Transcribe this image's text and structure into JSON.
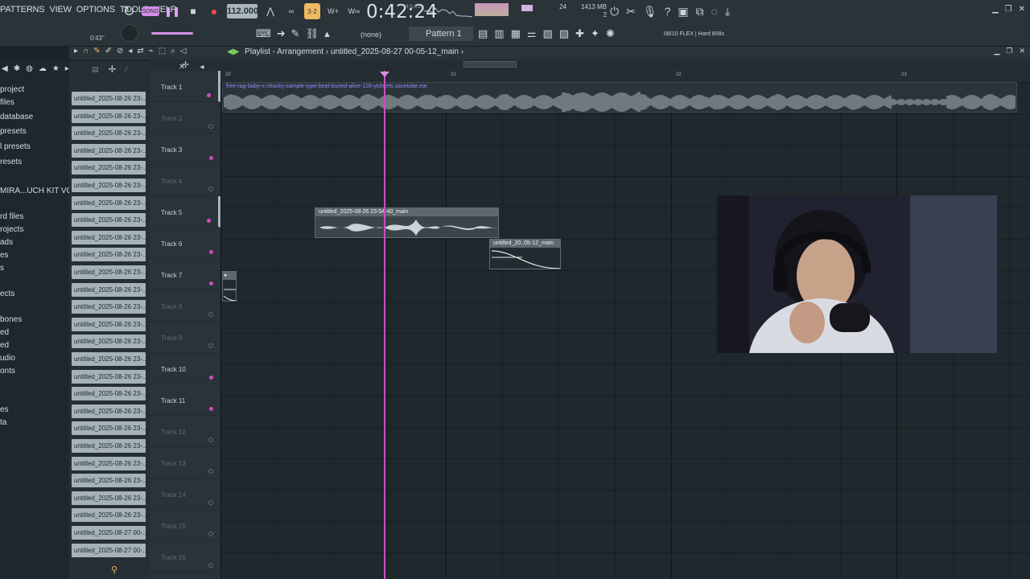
{
  "menu": [
    "PATTERNS",
    "VIEW",
    "OPTIONS",
    "TOOLS",
    "HELP"
  ],
  "transport": {
    "tempo": "112.000",
    "time": "0:42:24",
    "time_unit": "M:S:CS",
    "memory": "1413 MB",
    "memory_sub": "2",
    "cpu": "24",
    "position_label": "0'43\""
  },
  "toolbar2": {
    "none_label": "(none)",
    "pattern": "Pattern 1",
    "preset": "08/10  FLEX | Hard 808s"
  },
  "sidebar": {
    "items": [
      "project",
      "files",
      "database",
      "presets",
      "l presets",
      "resets",
      "MIRA...UCH KIT VOL 1",
      "rd files",
      "rojects",
      "ads",
      "es",
      "s",
      "ects",
      "bones",
      "ed",
      "ed",
      "udio",
      "onts",
      "es",
      "ta"
    ]
  },
  "files": [
    "untitled_2025-08-26 23-...",
    "untitled_2025-08-26 23-...",
    "untitled_2025-08-26 23-...",
    "untitled_2025-08-26 23-...",
    "untitled_2025-08-26 23-...",
    "untitled_2025-08-26 23-...",
    "untitled_2025-08-26 23-...",
    "untitled_2025-08-26 23-...",
    "untitled_2025-08-26 23-...",
    "untitled_2025-08-26 23-...",
    "untitled_2025-08-26 23-...",
    "untitled_2025-08-26 23-...",
    "untitled_2025-08-26 23-...",
    "untitled_2025-08-26 23-...",
    "untitled_2025-08-26 23-...",
    "untitled_2025-08-26 23-...",
    "untitled_2025-08-26 23-...",
    "untitled_2025-08-26 23-...",
    "untitled_2025-08-26 23-...",
    "untitled_2025-08-26 23-...",
    "untitled_2025-08-26 23-...",
    "untitled_2025-08-26 23-...",
    "untitled_2025-08-26 23-...",
    "untitled_2025-08-26 23-...",
    "untitled_2025-08-26 23-...",
    "untitled_2025-08-27 00-...",
    "untitled_2025-08-27 00-..."
  ],
  "playlist": {
    "title": "Playlist - Arrangement",
    "separator": "›",
    "project": "untitled_2025-08-27 00-05-12_main",
    "bars": [
      "20",
      "21",
      "22",
      "23"
    ]
  },
  "tracks": [
    {
      "name": "Track 1",
      "dim": false
    },
    {
      "name": "Track 2",
      "dim": true
    },
    {
      "name": "Track 3",
      "dim": false
    },
    {
      "name": "Track 4",
      "dim": true
    },
    {
      "name": "Track 5",
      "dim": false
    },
    {
      "name": "Track 6",
      "dim": false
    },
    {
      "name": "Track 7",
      "dim": false
    },
    {
      "name": "Track 8",
      "dim": true
    },
    {
      "name": "Track 9",
      "dim": true
    },
    {
      "name": "Track 10",
      "dim": false
    },
    {
      "name": "Track 11",
      "dim": false
    },
    {
      "name": "Track 12",
      "dim": true
    },
    {
      "name": "Track 13",
      "dim": true
    },
    {
      "name": "Track 14",
      "dim": true
    },
    {
      "name": "Track 15",
      "dim": true
    },
    {
      "name": "Track 16",
      "dim": true
    }
  ],
  "clips": {
    "track1": "free-rag-baby-x-chucky-sample-type-beat-buried-alive-128-ytshorts.savetube.me",
    "track5": "untitled_2025-08-26 23-54-40_main",
    "track6": "untitled_20..05-12_main"
  },
  "colors": {
    "accent": "#d14bc2",
    "clip_label": "#5c686e",
    "background": "#1f282d"
  }
}
